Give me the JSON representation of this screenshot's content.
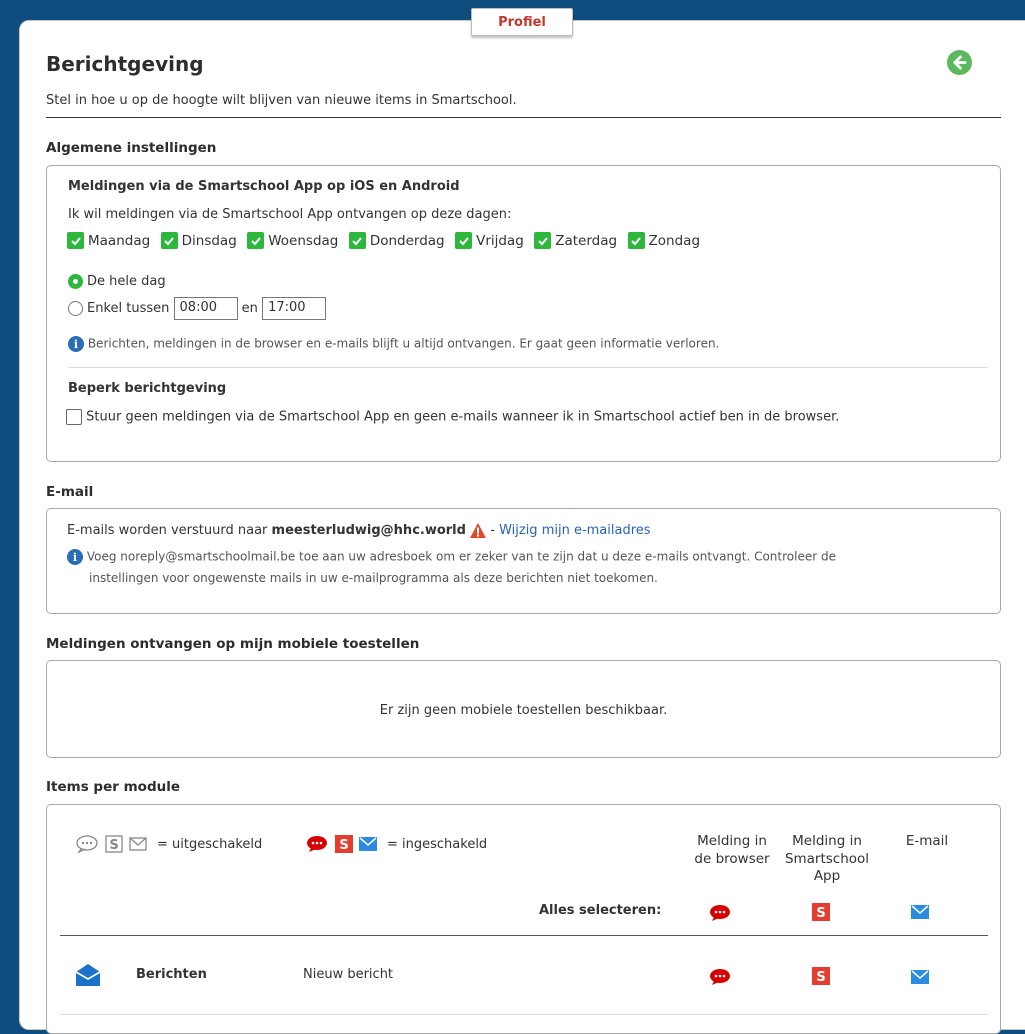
{
  "tab": {
    "label": "Profiel"
  },
  "header": {
    "title": "Berichtgeving",
    "subtitle": "Stel in hoe u op de hoogte wilt blijven van nieuwe items in Smartschool."
  },
  "general": {
    "section_label": "Algemene instellingen",
    "app_title": "Meldingen via de Smartschool App op iOS en Android",
    "days_intro": "Ik wil meldingen via de Smartschool App ontvangen op deze dagen:",
    "days": [
      {
        "label": "Maandag",
        "checked": true
      },
      {
        "label": "Dinsdag",
        "checked": true
      },
      {
        "label": "Woensdag",
        "checked": true
      },
      {
        "label": "Donderdag",
        "checked": true
      },
      {
        "label": "Vrijdag",
        "checked": true
      },
      {
        "label": "Zaterdag",
        "checked": true
      },
      {
        "label": "Zondag",
        "checked": true
      }
    ],
    "radio_whole_day": "De hele dag",
    "radio_between": "Enkel tussen",
    "time_from": "08:00",
    "time_and": "en",
    "time_to": "17:00",
    "info_text": "Berichten, meldingen in de browser en e-mails blijft u altijd ontvangen. Er gaat geen informatie verloren.",
    "limit_title": "Beperk berichtgeving",
    "limit_text": "Stuur geen meldingen via de Smartschool App en geen e-mails wanneer ik in Smartschool actief ben in de browser."
  },
  "email": {
    "section_label": "E-mail",
    "sent_to": "E-mails worden verstuurd naar",
    "address": "meesterludwig@hhc.world",
    "separator": "-",
    "change_link": "Wijzig mijn e-mailadres",
    "info_line1": "Voeg noreply@smartschoolmail.be toe aan uw adresboek om er zeker van te zijn dat u deze e-mails ontvangt. Controleer de",
    "info_line2": "instellingen voor ongewenste mails in uw e-mailprogramma als deze berichten niet toekomen."
  },
  "mobile": {
    "section_label": "Meldingen ontvangen op mijn mobiele toestellen",
    "empty_text": "Er zijn geen mobiele toestellen beschikbaar."
  },
  "modules": {
    "section_label": "Items per module",
    "legend_disabled": "= uitgeschakeld",
    "legend_enabled": "= ingeschakeld",
    "col_browser_1": "Melding in",
    "col_browser_2": "de browser",
    "col_app_1": "Melding in",
    "col_app_2": "Smartschool",
    "col_app_3": "App",
    "col_email": "E-mail",
    "select_all": "Alles selecteren:",
    "rows": [
      {
        "name": "Berichten",
        "description": "Nieuw bericht",
        "browser": true,
        "app": true,
        "email": true
      }
    ]
  },
  "colors": {
    "brand_blue": "#0e4d7e",
    "check_green": "#2db83d",
    "browser_red": "#d60000",
    "app_red": "#e43d2f",
    "email_blue": "#2b8be0",
    "link_blue": "#2a62b5"
  }
}
